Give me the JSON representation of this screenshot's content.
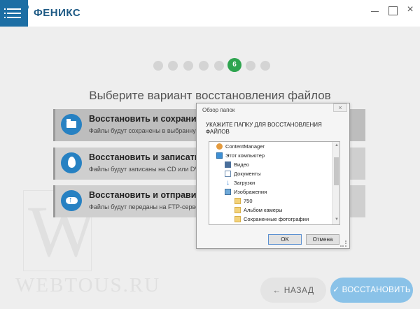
{
  "app": {
    "title": "ФЕНИКС"
  },
  "window_controls": {
    "close_symbol": "×"
  },
  "wizard": {
    "current_step_label": "6",
    "heading": "Выберите вариант восстановления файлов",
    "options": [
      {
        "icon": "folder-icon",
        "title": "Восстановить и сохранить н",
        "description": "Файлы будут сохранены в выбранную"
      },
      {
        "icon": "flame-icon",
        "title": "Восстановить и записать н",
        "description": "Файлы будут записаны на CD или DVD"
      },
      {
        "icon": "cloud-upload-icon",
        "title": "Восстановить и отправить",
        "description": "Файлы будут переданы на FTP-сервер"
      }
    ],
    "back_label": "НАЗАД",
    "restore_label": "ВОССТАНОВИТЬ",
    "back_icon": "←",
    "restore_icon": "✓"
  },
  "watermark": {
    "letter": "W",
    "text": "WEBTOUS.RU"
  },
  "dialog": {
    "title": "Обзор папок",
    "close_symbol": "×",
    "instruction": "УКАЖИТЕ ПАПКУ ДЛЯ ВОССТАНОВЛЕНИЯ ФАЙЛОВ",
    "tree": [
      {
        "label": "ContentManager",
        "icon": "user-icon"
      },
      {
        "label": "Этот компьютер",
        "icon": "computer-icon"
      },
      {
        "label": "Видео",
        "icon": "video-folder-icon"
      },
      {
        "label": "Документы",
        "icon": "documents-icon"
      },
      {
        "label": "Загрузки",
        "icon": "downloads-icon"
      },
      {
        "label": "Изображения",
        "icon": "pictures-icon"
      },
      {
        "label": "750",
        "icon": "folder-icon"
      },
      {
        "label": "Альбом камеры",
        "icon": "folder-icon"
      },
      {
        "label": "Сохраненные фотографии",
        "icon": "folder-icon"
      }
    ],
    "ok_label": "OK",
    "cancel_label": "Отмена"
  },
  "colors": {
    "brand_blue": "#1c6ea4",
    "step_active": "#2ea44f",
    "option_icon": "#2781c2",
    "restore_button": "#8ac2e8"
  }
}
